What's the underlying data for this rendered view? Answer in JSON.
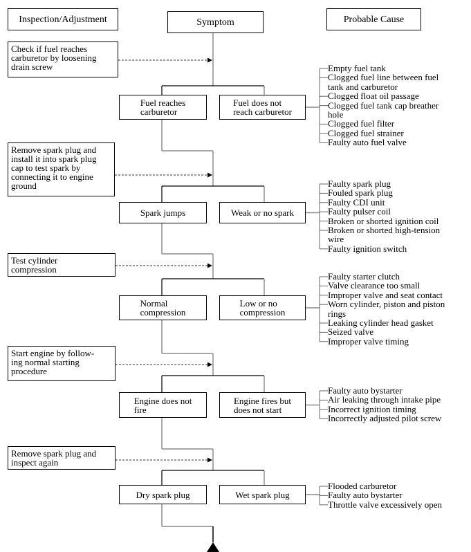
{
  "headers": {
    "inspection": "Inspection/Adjustment",
    "symptom": "Symptom",
    "cause": "Probable Cause"
  },
  "stages": [
    {
      "inspection": "Check if fuel reaches carburetor by loosening drain screw",
      "inspection_lines": [
        "Check if fuel reaches",
        "carburetor by loosening",
        "drain screw"
      ],
      "ok": [
        "Fuel reaches",
        "carburetor"
      ],
      "fail": [
        "Fuel does not",
        "reach carburetor"
      ],
      "causes": [
        "Empty fuel tank",
        "Clogged fuel line between fuel",
        "tank and carburetor",
        "Clogged float oil passage",
        "Clogged fuel tank cap breather",
        "hole",
        "Clogged fuel filter",
        "Clogged fuel strainer",
        "Faulty auto fuel valve"
      ]
    },
    {
      "inspection_lines": [
        "Remove spark plug and",
        "install it into spark plug",
        "cap to test spark by",
        "connecting it to engine",
        "ground"
      ],
      "ok": [
        "Spark jumps"
      ],
      "fail": [
        "Weak or no spark"
      ],
      "causes": [
        "Faulty spark plug",
        "Fouled spark plug",
        "Faulty CDI unit",
        "Faulty pulser coil",
        "Broken or shorted ignition coil",
        "Broken or shorted high-tension",
        "wire",
        "Faulty ignition switch"
      ]
    },
    {
      "inspection_lines": [
        "Test cylinder",
        "compression"
      ],
      "ok": [
        "Normal",
        "compression"
      ],
      "fail": [
        "Low or no",
        "compression"
      ],
      "causes": [
        "Faulty starter clutch",
        "Valve clearance too small",
        "Improper valve and seat contact",
        "Worn cylinder, piston and piston",
        "rings",
        "Leaking cylinder head gasket",
        "Seized valve",
        "Improper valve timing"
      ]
    },
    {
      "inspection_lines": [
        "Start engine by follow-",
        "ing normal starting",
        "procedure"
      ],
      "ok": [
        "Engine does not",
        "fire"
      ],
      "fail": [
        "Engine fires but",
        "does not start"
      ],
      "causes": [
        "Faulty auto bystarter",
        "Air leaking through intake pipe",
        "Incorrect ignition timing",
        "Incorrectly adjusted pilot screw"
      ]
    },
    {
      "inspection_lines": [
        "Remove spark plug and",
        "inspect again"
      ],
      "ok": [
        "Dry spark plug"
      ],
      "fail": [
        "Wet spark plug"
      ],
      "causes": [
        "Flooded carburetor",
        "Faulty auto bystarter",
        "Throttle valve excessively open"
      ]
    }
  ],
  "continuation": "arrow-up-icon"
}
